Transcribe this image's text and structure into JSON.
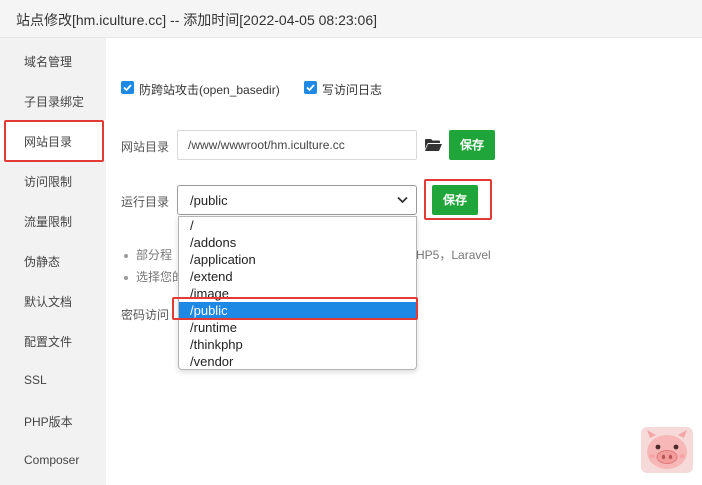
{
  "window": {
    "title": "站点修改[hm.iculture.cc] -- 添加时间[2022-04-05 08:23:06]"
  },
  "sidebar": {
    "items": [
      {
        "label": "域名管理"
      },
      {
        "label": "子目录绑定"
      },
      {
        "label": "网站目录"
      },
      {
        "label": "访问限制"
      },
      {
        "label": "流量限制"
      },
      {
        "label": "伪静态"
      },
      {
        "label": "默认文档"
      },
      {
        "label": "配置文件"
      },
      {
        "label": "SSL"
      },
      {
        "label": "PHP版本"
      },
      {
        "label": "Composer"
      }
    ],
    "active_index": 2
  },
  "options": {
    "anti_xss": {
      "label": "防跨站攻击(open_basedir)",
      "checked": true
    },
    "access_log": {
      "label": "写访问日志",
      "checked": true
    }
  },
  "site_dir": {
    "label": "网站目录",
    "value": "/www/wwwroot/hm.iculture.cc",
    "save_label": "保存"
  },
  "run_dir": {
    "label": "运行目录",
    "selected": "/public",
    "save_label": "保存",
    "options": [
      "/",
      "/addons",
      "/application",
      "/extend",
      "/image",
      "/public",
      "/runtime",
      "/thinkphp",
      "/vendor"
    ]
  },
  "tips": {
    "line1": "部分程",
    "line1_right": "HP5，Laravel",
    "line2": "选择您的"
  },
  "password_access": {
    "label": "密码访问"
  },
  "colors": {
    "accent_green": "#20a53a",
    "select_blue": "#1e88e5",
    "annotation_red": "#e33a36"
  }
}
